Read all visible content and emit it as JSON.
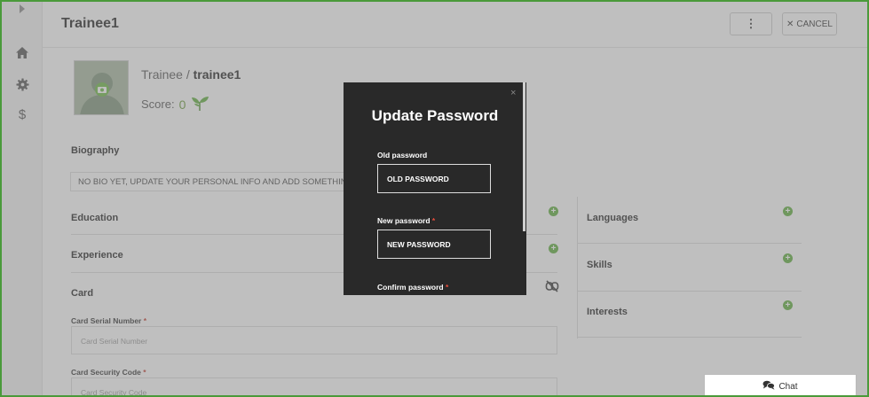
{
  "header": {
    "title": "Trainee1",
    "more_label": "⋮",
    "cancel_label": "CANCEL"
  },
  "sidebar": {
    "items": [
      {
        "icon": "caret-right-icon"
      },
      {
        "icon": "home-icon"
      },
      {
        "icon": "gear-icon"
      },
      {
        "icon": "dollar-icon"
      }
    ]
  },
  "profile": {
    "role": "Trainee",
    "separator": " / ",
    "username": "trainee1",
    "score_label": "Score:",
    "score_value": "0"
  },
  "biography": {
    "label": "Biography",
    "text": "NO BIO YET, UPDATE YOUR PERSONAL INFO AND ADD SOMETHING ABOUT YOU..."
  },
  "sections": {
    "education": "Education",
    "experience": "Experience",
    "card": "Card",
    "languages": "Languages",
    "skills": "Skills",
    "interests": "Interests"
  },
  "card": {
    "serial_label": "Card Serial Number",
    "serial_placeholder": "Card Serial Number",
    "security_label": "Card Security Code",
    "security_placeholder": "Card Security Code",
    "required_mark": "*"
  },
  "chat": {
    "label": "Chat"
  },
  "modal": {
    "title": "Update Password",
    "close": "×",
    "old_label": "Old password",
    "old_placeholder": "OLD PASSWORD",
    "new_label": "New password",
    "new_placeholder": "NEW PASSWORD",
    "confirm_label": "Confirm password",
    "required_mark": "*"
  },
  "colors": {
    "accent": "#5fae3c",
    "frame": "#4a9a3a",
    "modal_bg": "#292929",
    "required": "#c0392b"
  }
}
